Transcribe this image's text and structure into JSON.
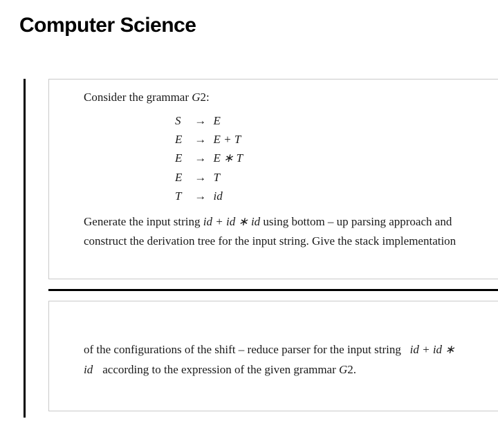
{
  "title": "Computer Science",
  "intro_prefix": "Consider the grammar ",
  "intro_grammar": "G",
  "intro_grammar_num": "2:",
  "grammar": [
    {
      "lhs": "S",
      "rhs": "E"
    },
    {
      "lhs": "E",
      "rhs": "E + T"
    },
    {
      "lhs": "E",
      "rhs": "E ∗ T"
    },
    {
      "lhs": "E",
      "rhs": "T"
    },
    {
      "lhs": "T",
      "rhs": "id"
    }
  ],
  "arrow": "→",
  "para1_a": "Generate the input string ",
  "para1_expr": "id + id ∗ id",
  "para1_b": "  using bottom – up parsing approach and construct the derivation tree for the input string. Give the stack implementation",
  "para2_a": "of the configurations of the shift – reduce parser for the input string",
  "para2_expr": "id + id ∗",
  "para2_id": "id",
  "para2_b": "according to the expression of the given grammar ",
  "para2_grammar": "G",
  "para2_grammar_num": "2."
}
